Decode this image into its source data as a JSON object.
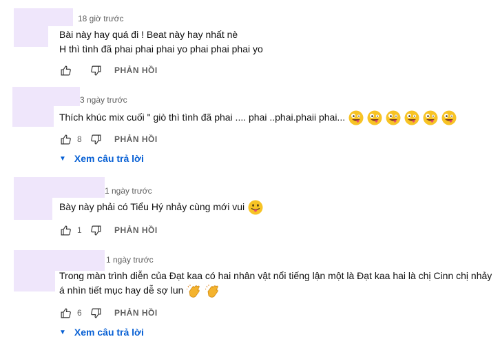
{
  "comments": [
    {
      "timestamp": "18 giờ trước",
      "lines": [
        "Bài này hay quá đi ! Beat này hay nhất nè",
        "H thì tình đã phai phai phai yo phai phai phai yo"
      ],
      "likes": "",
      "reply_label": "PHẢN HỒI",
      "view_replies": ""
    },
    {
      "timestamp": "3 ngày trước",
      "lines": [
        "Thích khúc mix cuối \" giò thì tình đã phai .... phai ..phai.phaii phai..."
      ],
      "emoji": [
        "zany-face-emoji",
        "zany-face-emoji",
        "zany-face-emoji",
        "zany-face-emoji",
        "zany-face-emoji",
        "zany-face-emoji"
      ],
      "likes": "8",
      "reply_label": "PHẢN HỒI",
      "view_replies": "Xem câu trả lời"
    },
    {
      "timestamp": "1 ngày trước",
      "lines": [
        "Bày này phải có Tiểu Hý nhảy cùng mới vui"
      ],
      "emoji": [
        "tongue-face-emoji"
      ],
      "likes": "1",
      "reply_label": "PHẢN HỒI",
      "view_replies": ""
    },
    {
      "timestamp": "1 ngày trước",
      "lines": [
        "Trong màn trình diễn của Đạt kaa có hai nhân vật nổi tiếng lận một là Đạt kaa hai là chị Cinn chị nhảy",
        "á nhìn tiết mục hay dễ sợ lun"
      ],
      "emoji": [
        "clapping-hands-emoji",
        "clapping-hands-emoji"
      ],
      "likes": "6",
      "reply_label": "PHẢN HỒI",
      "view_replies": "Xem câu trả lời"
    }
  ],
  "colors": {
    "link": "#065fd4",
    "secondary_text": "#606060",
    "redaction": "#efe6fb"
  },
  "icons": {
    "like": "thumb-up-icon",
    "dislike": "thumb-down-icon",
    "expand": "caret-down-icon"
  }
}
